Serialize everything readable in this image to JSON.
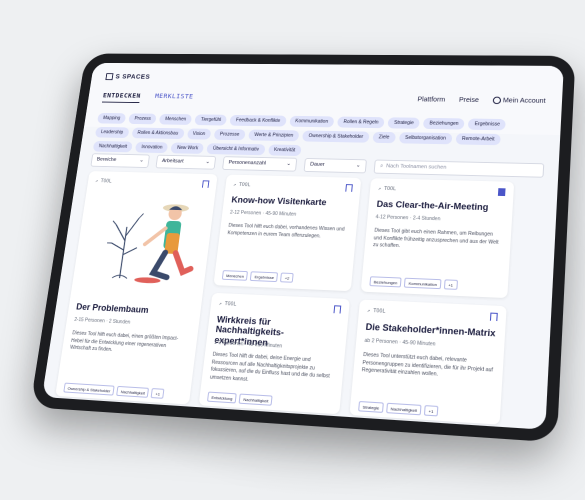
{
  "brand": {
    "name": "S SPACES"
  },
  "tabs": [
    {
      "label": "ENTDECKEN"
    },
    {
      "label": "MERKLISTE"
    }
  ],
  "topnav": {
    "plattform": "Plattform",
    "preise": "Preise",
    "account": "Mein Account"
  },
  "chips": [
    "Mapping",
    "Prozess",
    "Menschen",
    "Tiergefühl",
    "Feedback & Konflikte",
    "Kommunikation",
    "Rollen & Regeln",
    "Strategie",
    "Beziehungen",
    "Ergebnisse",
    "Leadership",
    "Rollen & Aktionsbau",
    "Vision",
    "Prozesse",
    "Werte & Prinzipien",
    "Ownership & Stakeholder",
    "Ziele",
    "Selbstorganisation",
    "Remote-Arbeit",
    "Nachhaltigkeit",
    "Innovation",
    "New Work",
    "Übersicht & Informativ",
    "Kreativität"
  ],
  "filters": {
    "f1": "Bereiche",
    "f2": "Arbeitsart",
    "f3": "Personenanzahl",
    "f4": "Dauer",
    "search_placeholder": "Nach Toolnamen suchen"
  },
  "cards": [
    {
      "label": "TOOL",
      "title": "Der Problembaum",
      "meta": "2-15 Personen · 2 Stunden",
      "desc": "Dieses Tool hilft euch dabei, einen größten Impact-Hebel für die Entwicklung einer regenerativen Wirtschaft zu finden.",
      "tags": [
        "Ownership & Stakeholder",
        "Nachhaltigkeit",
        "+1"
      ],
      "bookmarked": false
    },
    {
      "label": "TOOL",
      "title": "Know-how Visitenkarte",
      "meta": "2-12 Personen · 45-90 Minuten",
      "desc": "Dieses Tool hilft euch dabei, vorhandenes Wissen und Kompetenzen in eurem Team offenzulegen.",
      "tags": [
        "Menschen",
        "Ergebnisse",
        "+2"
      ],
      "bookmarked": false
    },
    {
      "label": "TOOL",
      "title": "Das Clear-the-Air-Meeting",
      "meta": "4-12 Personen · 2-4 Stunden",
      "desc": "Dieses Tool gibt euch einen Rahmen, um Reibungen und Konflikte frühzeitig anzusprechen und aus der Welt zu schaffen.",
      "tags": [
        "Beziehungen",
        "Kommunikation",
        "+1"
      ],
      "bookmarked": true
    },
    {
      "label": "TOOL",
      "title": "Wirkkreis für Nachhaltigkeits-expert*innen",
      "meta": "1-2 Personen · 45-210 Minuten",
      "desc": "Dieses Tool hilft dir dabei, deine Energie und Ressourcen auf alle Nachhaltigkeitsprojekte zu fokussieren, auf die du Einfluss hast und die du selbst umsetzen kannst.",
      "tags": [
        "Entwicklung",
        "Nachhaltigkeit"
      ],
      "bookmarked": false
    },
    {
      "label": "TOOL",
      "title": "Die Stakeholder*innen-Matrix",
      "meta": "ab 2 Personen · 45-90 Minuten",
      "desc": "Dieses Tool unterstützt euch dabei, relevante Personengruppen zu identifizieren, die für ihr Projekt auf Regenerativität einzahlen wollen.",
      "tags": [
        "Strategie",
        "Nachhaltigkeit",
        "+1"
      ],
      "bookmarked": false
    }
  ]
}
